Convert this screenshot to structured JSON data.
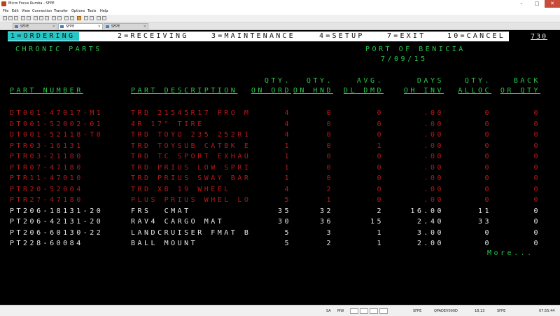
{
  "window": {
    "title": "Micro Focus Rumba - SFPE"
  },
  "menu": [
    "File",
    "Edit",
    "View",
    "Connection",
    "Transfer",
    "Options",
    "Tools",
    "Help"
  ],
  "tabs": [
    {
      "label": "SFPE",
      "active": false
    },
    {
      "label": "SFPE",
      "active": true
    },
    {
      "label": "SFPE",
      "active": false
    }
  ],
  "function_keys": [
    {
      "label": "1=ORDERING",
      "selected": true
    },
    {
      "label": "2=RECEIVING",
      "selected": false
    },
    {
      "label": "3=MAINTENANCE",
      "selected": false
    },
    {
      "label": "4=SETUP",
      "selected": false
    },
    {
      "label": "7=EXIT",
      "selected": false
    },
    {
      "label": "10=CANCEL",
      "selected": false
    }
  ],
  "screen_id": "730",
  "report": {
    "title": "CHRONIC PARTS",
    "location": "PORT OF BENICIA",
    "date": "7/09/15"
  },
  "columns": {
    "part_number": {
      "line1": "",
      "line2": "PART NUMBER"
    },
    "description": {
      "line1": "",
      "line2": "PART DESCRIPTION"
    },
    "qty_on_ord": {
      "line1": "QTY.",
      "line2": "ON ORD"
    },
    "qty_on_hnd": {
      "line1": "QTY.",
      "line2": "ON HND"
    },
    "avg_dl_dmd": {
      "line1": "AVG.",
      "line2": "DL DMD"
    },
    "days_oh_inv": {
      "line1": "DAYS",
      "line2": "OH INV"
    },
    "qty_alloc": {
      "line1": "QTY.",
      "line2": "ALLOC"
    },
    "back_or_qty": {
      "line1": "BACK",
      "line2": "OR QTY"
    }
  },
  "rows": [
    {
      "part": "DT001-47017-M1",
      "desc": "TRD 21545R17 PRO M",
      "on_ord": "4",
      "on_hnd": "0",
      "dmd": "0",
      "days": ".00",
      "alloc": "0",
      "back": "0",
      "color": "red"
    },
    {
      "part": "DT001-52002-01",
      "desc": "4R 17\" TIRE",
      "on_ord": "4",
      "on_hnd": "0",
      "dmd": "0",
      "days": ".00",
      "alloc": "0",
      "back": "0",
      "color": "red"
    },
    {
      "part": "DT001-52118-T0",
      "desc": "TRD TOYO 235 252R1",
      "on_ord": "4",
      "on_hnd": "0",
      "dmd": "0",
      "days": ".00",
      "alloc": "0",
      "back": "0",
      "color": "red"
    },
    {
      "part": "PTR03-16131",
      "desc": "TRD TOYSUB CATBK E",
      "on_ord": "1",
      "on_hnd": "0",
      "dmd": "1",
      "days": ".00",
      "alloc": "0",
      "back": "0",
      "color": "red"
    },
    {
      "part": "PTR03-21180",
      "desc": "TRD TC SPORT EXHAU",
      "on_ord": "1",
      "on_hnd": "0",
      "dmd": "0",
      "days": ".00",
      "alloc": "0",
      "back": "0",
      "color": "red"
    },
    {
      "part": "PTR07-47180",
      "desc": "TRD PRIUS LOW SPRI",
      "on_ord": "1",
      "on_hnd": "0",
      "dmd": "0",
      "days": ".00",
      "alloc": "0",
      "back": "0",
      "color": "red"
    },
    {
      "part": "PTR11-47010",
      "desc": "TRD PRIUS SWAY BAR",
      "on_ord": "1",
      "on_hnd": "0",
      "dmd": "0",
      "days": ".00",
      "alloc": "0",
      "back": "0",
      "color": "red"
    },
    {
      "part": "PTR20-52004",
      "desc": "TRD XB 19 WHEEL",
      "on_ord": "4",
      "on_hnd": "2",
      "dmd": "0",
      "days": ".00",
      "alloc": "0",
      "back": "0",
      "color": "red"
    },
    {
      "part": "PTR27-47180",
      "desc": "PLUS PRIUS WHEL LO",
      "on_ord": "5",
      "on_hnd": "1",
      "dmd": "0",
      "days": ".00",
      "alloc": "0",
      "back": "0",
      "color": "red"
    },
    {
      "part": "PT206-18131-20",
      "desc": "FRS  CMAT",
      "on_ord": "35",
      "on_hnd": "32",
      "dmd": "2",
      "days": "16.00",
      "alloc": "11",
      "back": "0",
      "color": "white"
    },
    {
      "part": "PT206-42131-20",
      "desc": "RAV4 CARGO MAT",
      "on_ord": "30",
      "on_hnd": "36",
      "dmd": "15",
      "days": "2.40",
      "alloc": "33",
      "back": "0",
      "color": "white"
    },
    {
      "part": "PT206-60130-22",
      "desc": "LANDCRUISER FMAT B",
      "on_ord": "5",
      "on_hnd": "3",
      "dmd": "1",
      "days": "3.00",
      "alloc": "0",
      "back": "0",
      "color": "white"
    },
    {
      "part": "PT228-60084",
      "desc": "BALL MOUNT",
      "on_ord": "5",
      "on_hnd": "2",
      "dmd": "1",
      "days": "2.00",
      "alloc": "0",
      "back": "0",
      "color": "white"
    }
  ],
  "more_label": "More...",
  "status": {
    "mode": "SA",
    "mw": "MW",
    "session": "SFPE",
    "host": "QPADEV000D",
    "cursor_pos": "18,13",
    "session2": "SFPE",
    "time": "07:55:44"
  }
}
